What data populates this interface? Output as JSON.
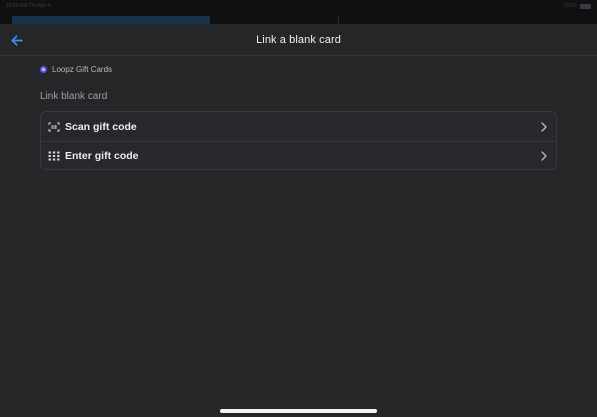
{
  "status_bar": {
    "left_text": "10:09 AM   Thu Apr 4",
    "right_text": "100%"
  },
  "nav": {
    "title": "Link a blank card"
  },
  "brand": {
    "name": "Loopz Gift Cards"
  },
  "section": {
    "heading": "Link blank card"
  },
  "options": [
    {
      "label": "Scan gift code",
      "icon": "scan-code-icon"
    },
    {
      "label": "Enter gift code",
      "icon": "keypad-icon"
    }
  ],
  "colors": {
    "accent": "#3b8ff0",
    "brand_logo": "#5b57e8",
    "background": "#252628"
  }
}
